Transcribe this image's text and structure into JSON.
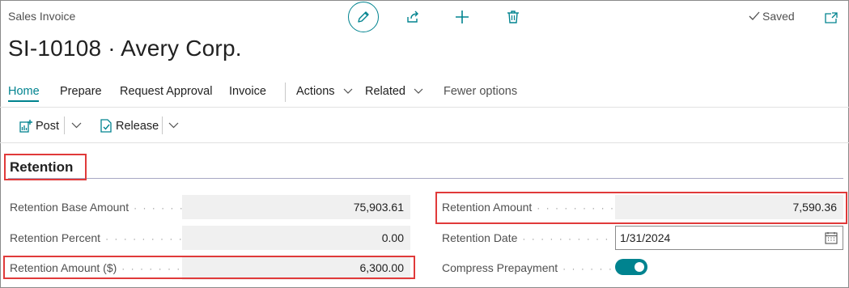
{
  "page": {
    "doc_type": "Sales Invoice",
    "title": "SI-10108 · Avery Corp.",
    "saved_label": "Saved"
  },
  "top_actions": [
    {
      "name": "edit-icon"
    },
    {
      "name": "share-icon"
    },
    {
      "name": "new-icon"
    },
    {
      "name": "delete-icon"
    },
    {
      "name": "open-in-new-window-icon"
    }
  ],
  "nav": {
    "home": "Home",
    "prepare": "Prepare",
    "request_approval": "Request Approval",
    "invoice": "Invoice",
    "actions": "Actions",
    "related": "Related",
    "fewer_options": "Fewer options"
  },
  "toolbar": {
    "post": "Post",
    "release": "Release"
  },
  "section": {
    "title": "Retention"
  },
  "fields": {
    "retention_base_amount": {
      "label": "Retention Base Amount",
      "value": "75,903.61"
    },
    "retention_percent": {
      "label": "Retention Percent",
      "value": "0.00"
    },
    "retention_amount_dollar": {
      "label": "Retention Amount ($)",
      "value": "6,300.00"
    },
    "retention_amount": {
      "label": "Retention Amount",
      "value": "7,590.36"
    },
    "retention_date": {
      "label": "Retention Date",
      "value": "1/31/2024"
    },
    "compress_prepayment": {
      "label": "Compress Prepayment",
      "value": "on"
    }
  },
  "colors": {
    "accent": "#00838f",
    "highlight": "#e03a3a"
  }
}
